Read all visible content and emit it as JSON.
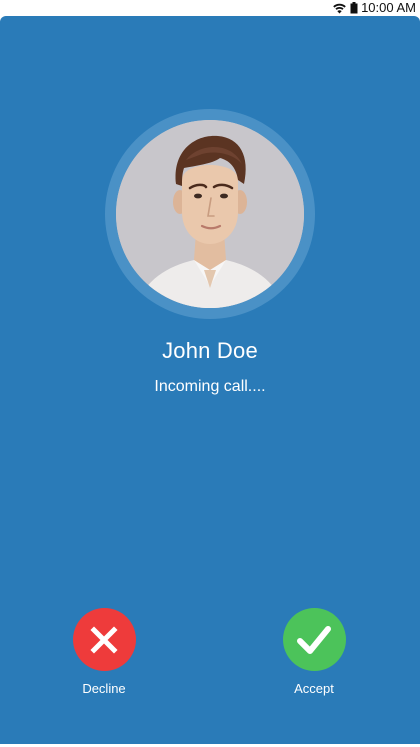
{
  "status_bar": {
    "time": "10:00 AM",
    "wifi_icon": "wifi-icon",
    "battery_icon": "battery-icon"
  },
  "call": {
    "caller_name": "John Doe",
    "status": "Incoming call....",
    "avatar_icon": "caller-avatar"
  },
  "actions": {
    "decline": {
      "label": "Decline",
      "icon": "close-icon",
      "color": "#ee3b3b"
    },
    "accept": {
      "label": "Accept",
      "icon": "check-icon",
      "color": "#4cc35a"
    }
  },
  "colors": {
    "background": "#2a7bb8",
    "avatar_ring": "#4a91c6"
  }
}
